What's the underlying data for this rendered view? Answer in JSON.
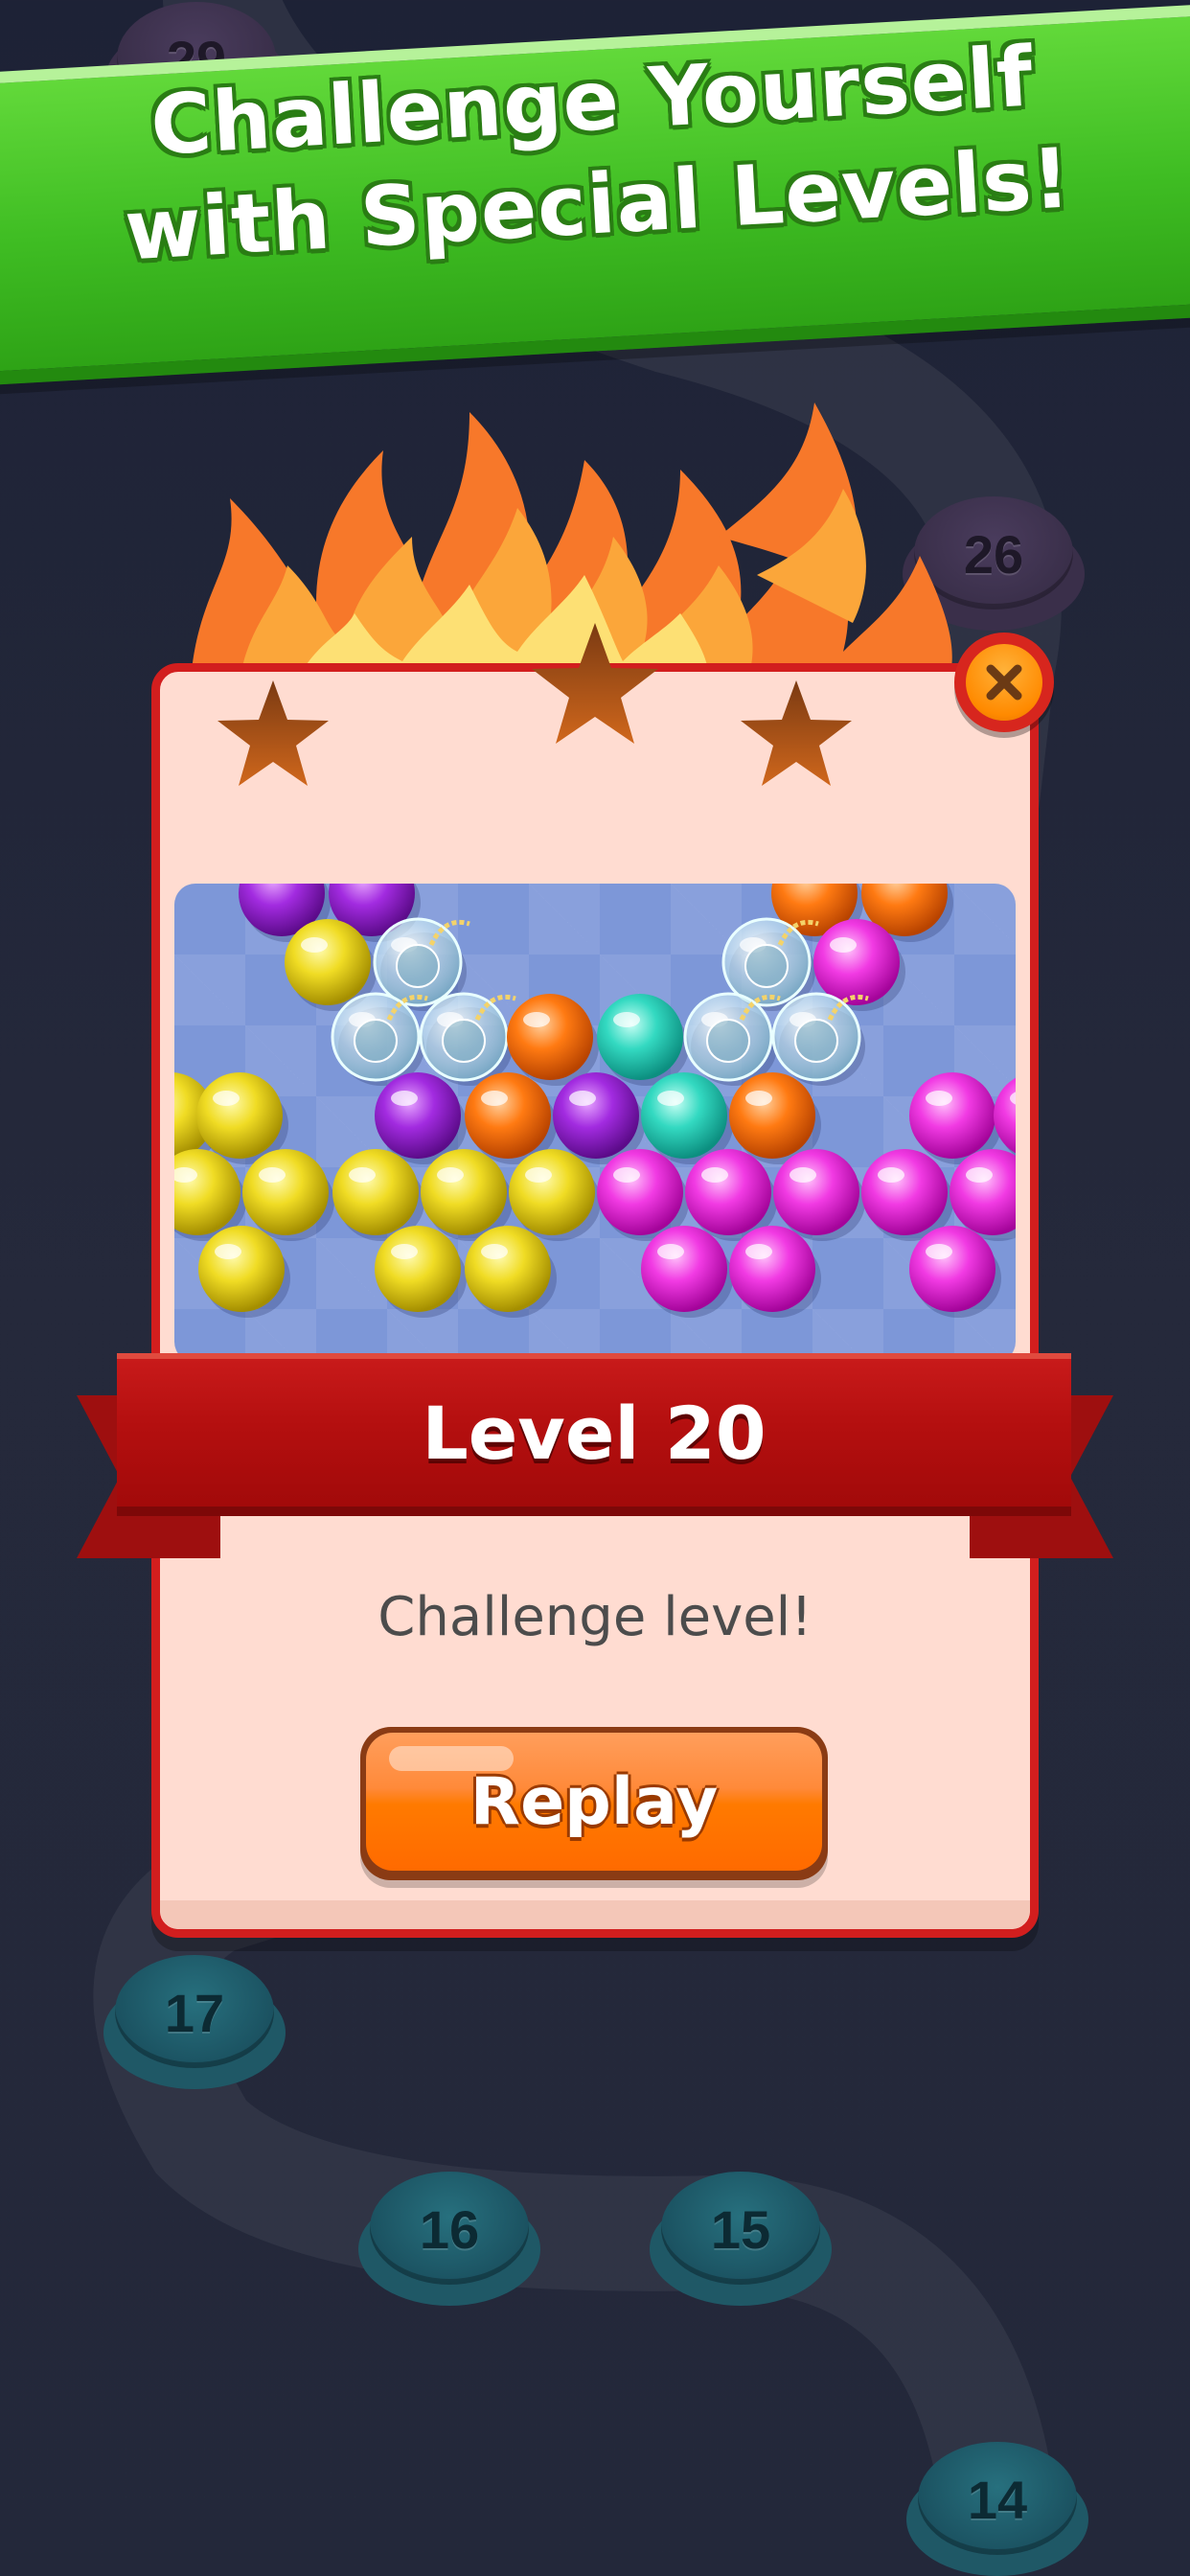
{
  "promo_banner": {
    "line1": "Challenge Yourself",
    "line2": "with Special Levels!"
  },
  "map": {
    "levels": [
      {
        "number": "29",
        "state": "locked"
      },
      {
        "number": "26",
        "state": "locked"
      },
      {
        "number": "17",
        "state": "unlocked"
      },
      {
        "number": "16",
        "state": "unlocked"
      },
      {
        "number": "15",
        "state": "unlocked"
      },
      {
        "number": "14",
        "state": "unlocked"
      }
    ]
  },
  "dialog": {
    "stars_earned": 0,
    "stars_total": 3,
    "title": "Level 20",
    "subtitle": "Challenge level!",
    "primary_button": "Replay",
    "close_icon": "close-icon"
  },
  "colors": {
    "banner_green": "#3fbd23",
    "dialog_bg": "#ffdcd1",
    "dialog_border": "#d21e1e",
    "ribbon_red": "#b40f0f",
    "button_orange": "#ff7a00",
    "close_orange": "#ff8a00"
  },
  "level_preview": {
    "bubble_colors": [
      "purple",
      "yellow",
      "orange",
      "cyan",
      "magenta",
      "bomb"
    ]
  }
}
